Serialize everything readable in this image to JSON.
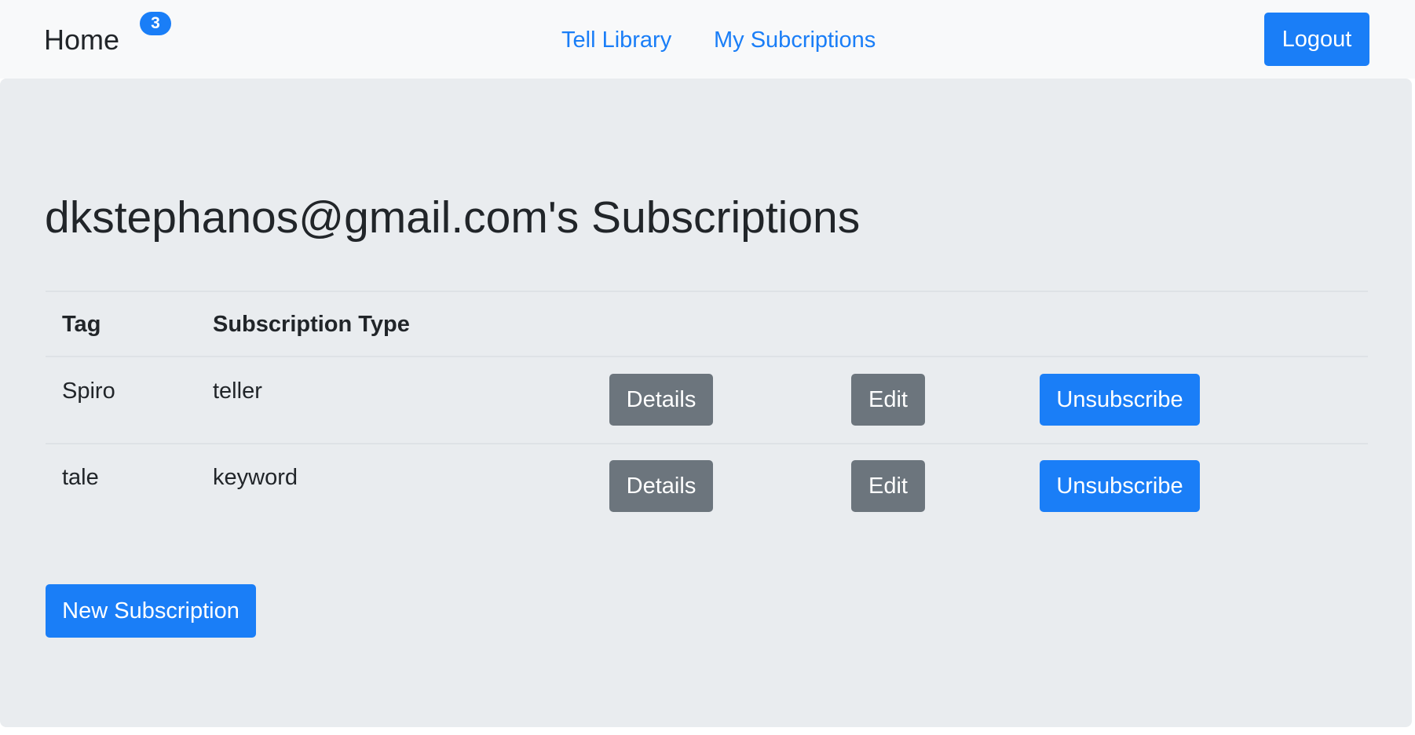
{
  "navbar": {
    "brand": "Home",
    "badge_count": "3",
    "links": [
      {
        "label": "Tell Library"
      },
      {
        "label": "My Subcriptions"
      }
    ],
    "logout_label": "Logout"
  },
  "main": {
    "title": "dkstephanos@gmail.com's Subscriptions",
    "table": {
      "headers": [
        "Tag",
        "Subscription Type"
      ],
      "rows": [
        {
          "tag": "Spiro",
          "type": "teller",
          "details_label": "Details",
          "edit_label": "Edit",
          "unsubscribe_label": "Unsubscribe"
        },
        {
          "tag": "tale",
          "type": "keyword",
          "details_label": "Details",
          "edit_label": "Edit",
          "unsubscribe_label": "Unsubscribe"
        }
      ]
    },
    "new_subscription_label": "New Subscription"
  },
  "colors": {
    "primary": "#1a7ef7",
    "secondary": "#6c757d",
    "navbar_bg": "#f8f9fa",
    "jumbotron_bg": "#e9ecef",
    "text": "#212529"
  }
}
